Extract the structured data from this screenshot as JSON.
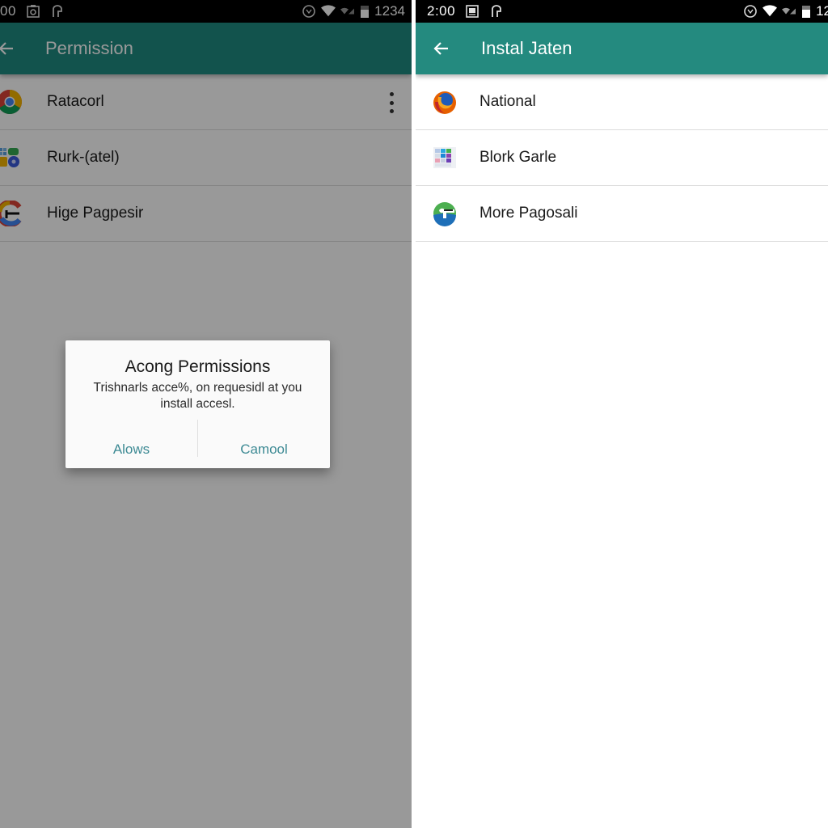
{
  "left_screen": {
    "status_bar": {
      "time": "00",
      "clock": "1234",
      "icons": [
        "photo-notification-icon",
        "key-notification-icon",
        "data-saver-icon",
        "wifi-icon",
        "signal-icon",
        "battery-icon"
      ]
    },
    "app_bar": {
      "back_icon": "arrow-left-icon",
      "title": "Permission"
    },
    "list": [
      {
        "label": "Ratacorl",
        "icon": "chrome-icon",
        "has_menu": true
      },
      {
        "label": "Rurk-(atel)",
        "icon": "app-grid-icon",
        "has_menu": false
      },
      {
        "label": "Hige Pagpesir",
        "icon": "pagpesir-icon",
        "has_menu": false
      }
    ],
    "dialog": {
      "title": "Acong Permissions",
      "message": "Trishnarls acce%, on requesidl at you install accesl.",
      "buttons": {
        "allow": "Alows",
        "cancel": "Camool"
      }
    }
  },
  "right_screen": {
    "status_bar": {
      "time": "2:00",
      "clock": "12",
      "icons": [
        "photo-notification-icon",
        "key-notification-icon",
        "data-saver-icon",
        "wifi-icon",
        "signal-icon",
        "battery-icon"
      ]
    },
    "app_bar": {
      "back_icon": "arrow-left-icon",
      "title": "Instal Jaten"
    },
    "list": [
      {
        "label": "National",
        "icon": "firefox-icon"
      },
      {
        "label": "Blork Garle",
        "icon": "tile-grid-icon"
      },
      {
        "label": "More Pagosali",
        "icon": "pagosali-icon"
      }
    ]
  },
  "colors": {
    "app_bar_teal": "#248a7f",
    "dialog_button_text": "#3d8a94",
    "scrim": "rgba(0,0,0,0.40)"
  }
}
